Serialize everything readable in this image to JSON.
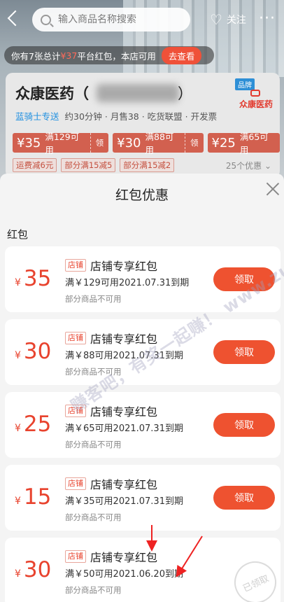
{
  "topbar": {
    "search_placeholder": "输入商品名称搜索",
    "follow_label": "关注"
  },
  "notice": {
    "prefix": "你有7张总计",
    "amount": "¥37",
    "suffix": "平台红包，本店可用",
    "button": "去查看"
  },
  "store": {
    "name": "众康医药（",
    "name_close": "）",
    "brand_badge": "品牌",
    "brand_name": "众康医药",
    "delivery": "蓝骑士专送",
    "meta": "约30分钟 · 月售38 · 吃货联盟 · 开发票",
    "mini_coupons": [
      {
        "value": "¥35",
        "cond": "满129可用",
        "take": "领"
      },
      {
        "value": "¥30",
        "cond": "满88可用",
        "take": "领"
      },
      {
        "value": "¥25",
        "cond": "满65可用",
        "take": ""
      }
    ],
    "promos": [
      "运费减6元",
      "部分满15减5",
      "部分满15减2"
    ],
    "promo_count": "25个优惠 ⌄"
  },
  "sheet": {
    "title": "红包优惠",
    "section_label": "红包",
    "coupons": [
      {
        "yen": "¥",
        "value": "35",
        "tag": "店铺",
        "name": "店铺专享红包",
        "cond": "满￥129可用2021.07.31到期",
        "note": "部分商品不可用",
        "button": "领取"
      },
      {
        "yen": "¥",
        "value": "30",
        "tag": "店铺",
        "name": "店铺专享红包",
        "cond": "满￥88可用2021.07.31到期",
        "note": "部分商品不可用",
        "button": "领取"
      },
      {
        "yen": "¥",
        "value": "25",
        "tag": "店铺",
        "name": "店铺专享红包",
        "cond": "满￥65可用2021.07.31到期",
        "note": "部分商品不可用",
        "button": "领取"
      },
      {
        "yen": "¥",
        "value": "15",
        "tag": "店铺",
        "name": "店铺专享红包",
        "cond": "满￥35可用2021.07.31到期",
        "note": "部分商品不可用",
        "button": "领取"
      },
      {
        "yen": "¥",
        "value": "30",
        "tag": "店铺",
        "name": "店铺专享红包",
        "cond": "满￥50可用2021.06.20到期",
        "note": "部分商品不可用",
        "stamp": "已领取"
      }
    ]
  },
  "watermark": "赚客吧，有奖一起赚！ www.zuanke8.com",
  "colors": {
    "accent": "#ee5230",
    "value_red": "#e8432e",
    "brand_blue": "#2e8fd6"
  }
}
